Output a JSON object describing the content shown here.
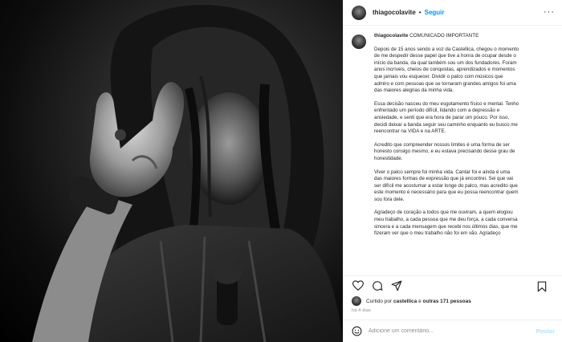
{
  "header": {
    "username": "thiagocolavite",
    "separator": "•",
    "follow_label": "Seguir",
    "more_label": "···"
  },
  "caption": {
    "username": "thiagocolavite",
    "title": "COMUNICADO IMPORTANTE",
    "paragraphs": [
      [
        "Depois de 15 anos sendo a voz da Castellica, chegou o momento",
        "de me despedir desse papel que tive a honra de ocupar desde o",
        "início da banda, da qual também sou um dos fundadores. Foram",
        "anos incríveis, cheios de conquistas, aprendizados e momentos",
        "que jamais vou esquecer. Dividir o palco com músicos que",
        "admiro e com pessoas que se tornaram grandes amigos foi uma",
        "das maiores alegrias da minha vida."
      ],
      [
        "Essa decisão nasceu do meu esgotamento físico e mental. Tenho",
        "enfrentado um período difícil, lidando com a depressão e",
        "ansiedade, e senti que era hora de parar um pouco. Por isso,",
        "decidi deixar a banda seguir seu caminho enquanto eu busco me",
        "reencontrar na VIDA e na ARTE."
      ],
      [
        "Acredito que compreender nossos limites é uma forma de ser",
        "honesto consigo mesmo, e eu estava precisando desse grau de",
        "honestidade."
      ],
      [
        "Viver o palco sempre foi minha vida. Cantar foi e ainda é uma",
        "das maiores formas de expressão que já encontrei. Sei que vai",
        "ser difícil me acostumar a estar longe do palco, mas acredito que",
        "este momento é necessário para que eu possa reencontrar quem",
        "sou fora dele."
      ],
      [
        "Agradeço de coração a todos que me ouviram, a quem elogiou",
        "meu trabalho, a cada pessoa que me deu força, a cada conversa",
        "sincera e a cada mensagem que recebi nos últimos dias, que me",
        "fizeram ver que o meu trabalho não foi em vão. Agradeço"
      ]
    ]
  },
  "likes": {
    "prefix": "Curtido por",
    "first_user": "castellica",
    "connector": "e",
    "others": "outras 171 pessoas"
  },
  "timestamp": "há 4 dias",
  "comment": {
    "placeholder": "Adicione um comentário...",
    "post_label": "Postar"
  },
  "icons": {
    "like": "heart-icon",
    "comment": "comment-icon",
    "share": "share-icon",
    "save": "bookmark-icon",
    "emoji": "emoji-icon"
  },
  "colors": {
    "follow": "#0095f6",
    "post_disabled": "#b2dffc",
    "muted": "#8e8e8e"
  }
}
